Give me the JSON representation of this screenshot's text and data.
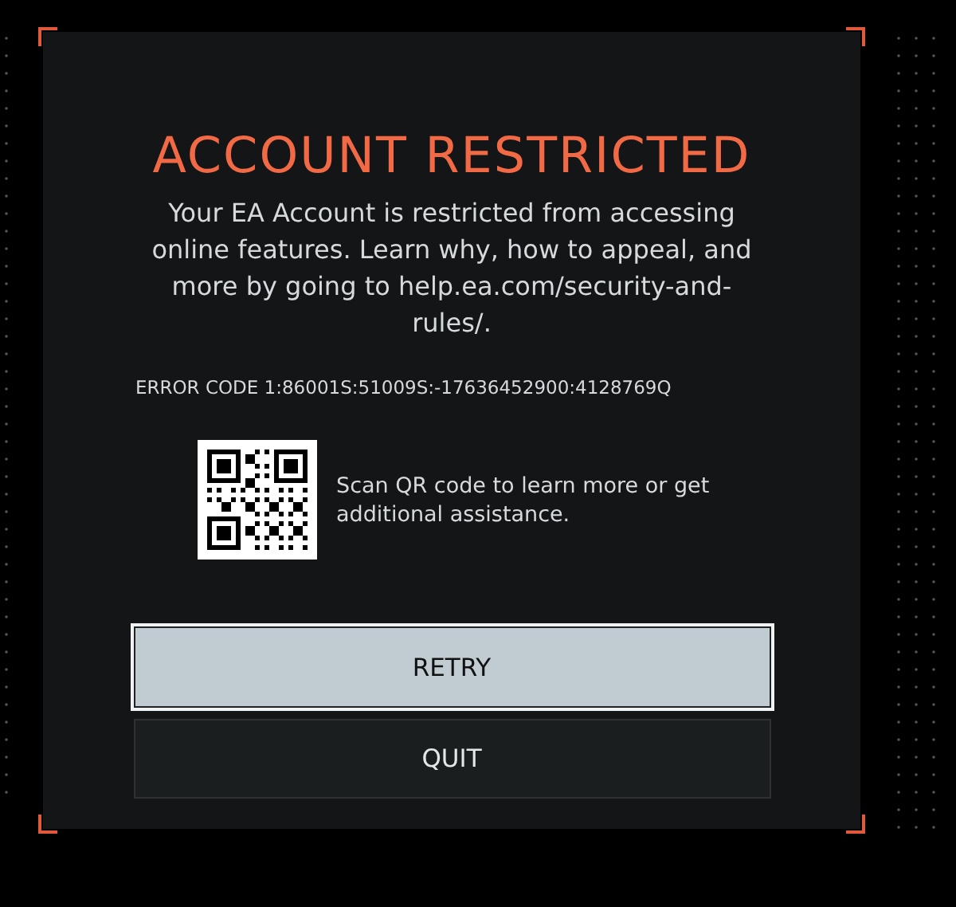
{
  "dialog": {
    "title": "ACCOUNT RESTRICTED",
    "message": "Your EA Account is restricted from accessing online features. Learn why, how to appeal, and more by going to help.ea.com/security-and-rules/.",
    "error_code": "ERROR CODE 1:86001S:51009S:-17636452900:4128769Q",
    "qr_caption": "Scan QR code to learn more or get additional assistance.",
    "buttons": [
      {
        "label": "RETRY",
        "selected": true
      },
      {
        "label": "QUIT",
        "selected": false
      }
    ]
  }
}
